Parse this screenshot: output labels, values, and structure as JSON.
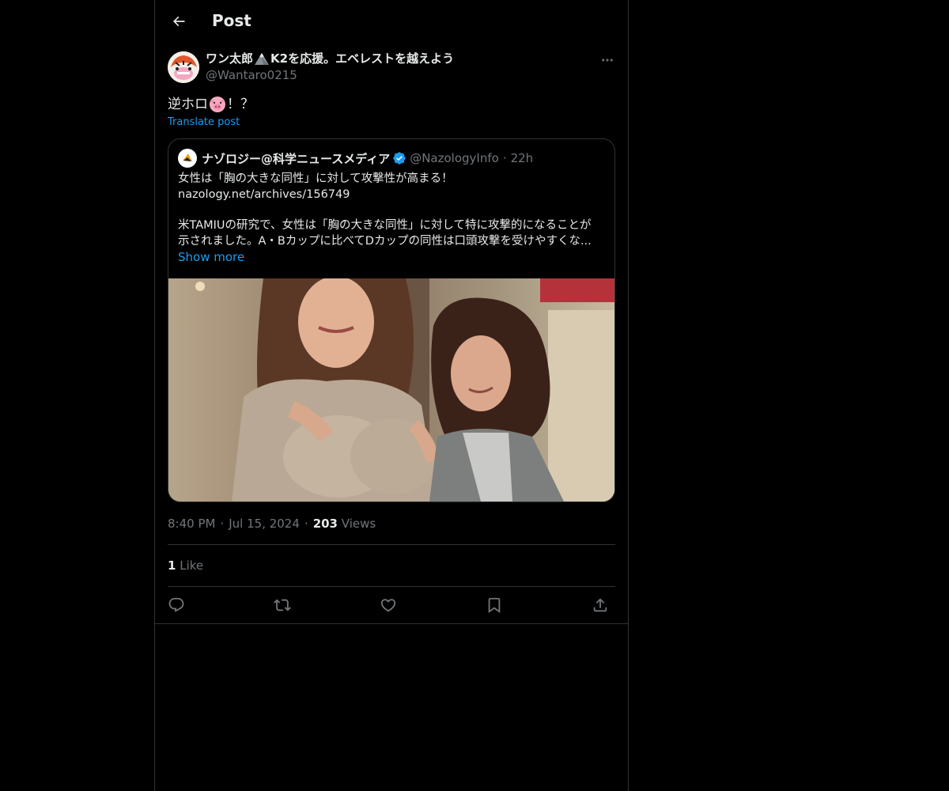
{
  "header": {
    "title": "Post"
  },
  "post": {
    "author_name": "ワン太郎",
    "author_name_rest": "K2を応援。エベレストを越えよう",
    "author_handle": "@Wantaro0215",
    "text_before": "逆ホロ",
    "text_after": "！？",
    "translate_label": "Translate post",
    "time": "8:40 PM",
    "date": "Jul 15, 2024",
    "views_count": "203",
    "views_label": "Views",
    "likes_count": "1",
    "likes_label": "Like"
  },
  "quote": {
    "name": "ナゾロジー@科学ニュースメディア",
    "handle": "@NazologyInfo",
    "separator": "·",
    "time": "22h",
    "line1": "女性は「胸の大きな同性」に対して攻撃性が高まる！",
    "line2": "nazology.net/archives/156749",
    "line3": "米TAMIUの研究で、女性は「胸の大きな同性」に対して特に攻撃的になることが",
    "line4": "示されました。A・Bカップに比べてDカップの同性は口頭攻撃を受けやすくな...",
    "show_more": "Show more"
  },
  "colors": {
    "accent": "#1d9bf0",
    "background": "#000000",
    "border": "#2f3336",
    "secondary_text": "#71767b",
    "verified": "#1d9bf0"
  },
  "icons": {
    "back": "arrow-left-icon",
    "more": "more-horizontal-icon",
    "mountain": "mountain-emoji",
    "pig": "pig-emoji",
    "verified": "verified-badge-icon",
    "reply": "reply-icon",
    "repost": "repost-icon",
    "like": "heart-icon",
    "bookmark": "bookmark-icon",
    "share": "share-icon"
  }
}
